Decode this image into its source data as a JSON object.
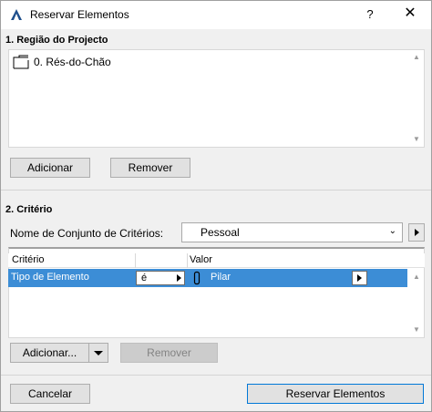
{
  "window": {
    "title": "Reservar Elementos",
    "help_label": "?",
    "close_label": "✕"
  },
  "region": {
    "heading": "1. Região do Projecto",
    "items": [
      {
        "label": "0. Rés-do-Chão",
        "icon": "story-icon"
      }
    ],
    "add_label": "Adicionar",
    "remove_label": "Remover"
  },
  "criteria": {
    "heading": "2. Critério",
    "set_name_label": "Nome de Conjunto de Critérios:",
    "set_name_value": "Pessoal",
    "columns": [
      "Critério",
      "Valor"
    ],
    "rows": [
      {
        "criterion": "Tipo de Elemento",
        "operator": "é",
        "value_icon": "column-icon",
        "value": "Pilar"
      }
    ],
    "add_label": "Adicionar...",
    "remove_label": "Remover"
  },
  "footer": {
    "cancel_label": "Cancelar",
    "reserve_label": "Reservar Elementos"
  },
  "colors": {
    "selection": "#3c8dd6",
    "dialog_bg": "#f0f0f0",
    "button_bg": "#e1e1e1"
  }
}
